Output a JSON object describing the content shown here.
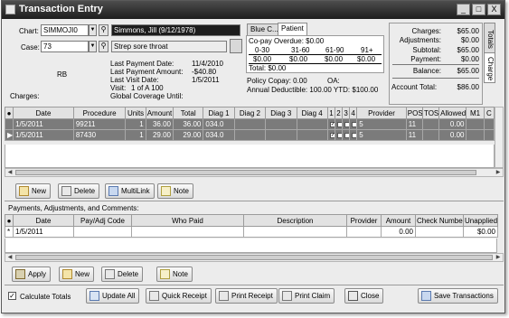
{
  "window": {
    "title": "Transaction Entry",
    "controls": {
      "minimize": "_",
      "maximize": "□",
      "close": "X"
    }
  },
  "patient": {
    "chart_label": "Chart:",
    "chart_value": "SIMMOJI0",
    "chart_name": "Simmons, Jill  (9/12/1978)",
    "case_label": "Case:",
    "case_value": "73",
    "case_desc": "Strep sore throat",
    "rb": "RB",
    "charges_label": "Charges:"
  },
  "payment_info": {
    "last_payment_date_label": "Last Payment Date:",
    "last_payment_date": "11/4/2010",
    "last_payment_amount_label": "Last Payment Amount:",
    "last_payment_amount": "-$40.80",
    "last_visit_date_label": "Last Visit Date:",
    "last_visit_date": "1/5/2011",
    "visit_label": "Visit:",
    "visit_value": "1   of  A 100",
    "global_coverage_label": "Global Coverage Until:"
  },
  "copay_panel": {
    "tabs": [
      "Blue C...",
      "Patient"
    ],
    "copay_overdue": "Co-pay Overdue: $0.00",
    "aging_headers": [
      "0-30",
      "31-60",
      "61-90",
      "91+"
    ],
    "aging_values": [
      "$0.00",
      "$0.00",
      "$0.00",
      "$0.00"
    ],
    "total": "Total: $0.00",
    "policy_copay": "Policy Copay: 0.00",
    "oa": "OA:",
    "annual_deductible": "Annual Deductible:  100.00  YTD:   $100.00"
  },
  "totals": {
    "rows": [
      {
        "label": "Charges:",
        "value": "$65.00"
      },
      {
        "label": "Adjustments:",
        "value": "$0.00"
      },
      {
        "label": "Subtotal:",
        "value": "$65.00"
      },
      {
        "label": "Payment:",
        "value": "$0.00"
      },
      {
        "label": "Balance:",
        "value": "$65.00"
      }
    ],
    "account_total_label": "Account Total:",
    "account_total": "$86.00",
    "side_tabs": [
      "Totals",
      "Charge"
    ]
  },
  "charges_grid": {
    "columns": [
      "Date",
      "Procedure",
      "Units",
      "Amount",
      "Total",
      "Diag 1",
      "Diag 2",
      "Diag 3",
      "Diag 4",
      "1",
      "2",
      "3",
      "4",
      "Provider",
      "POS",
      "TOS",
      "Allowed",
      "M1",
      "C"
    ],
    "rows": [
      {
        "date": "1/5/2011",
        "procedure": "99211",
        "units": "1",
        "amount": "36.00",
        "total": "36.00",
        "diag1": "034.0",
        "provider": "5",
        "pos": "11",
        "allowed": "0.00"
      },
      {
        "date": "1/5/2011",
        "procedure": "87430",
        "units": "1",
        "amount": "29.00",
        "total": "29.00",
        "diag1": "034.0",
        "provider": "5",
        "pos": "11",
        "allowed": "0.00"
      }
    ]
  },
  "charges_buttons": {
    "new": "New",
    "delete": "Delete",
    "multilink": "MultiLink",
    "note": "Note"
  },
  "payments_section_label": "Payments, Adjustments, and Comments:",
  "payments_grid": {
    "columns": [
      "Date",
      "Pay/Adj Code",
      "Who Paid",
      "Description",
      "Provider",
      "Amount",
      "Check Number",
      "Unapplied"
    ],
    "rows": [
      {
        "date": "1/5/2011",
        "amount": "0.00",
        "unapplied": "$0.00"
      }
    ]
  },
  "payments_buttons": {
    "apply": "Apply",
    "new": "New",
    "delete": "Delete",
    "note": "Note"
  },
  "footer": {
    "calculate_totals": "Calculate Totals",
    "update_all": "Update All",
    "quick_receipt": "Quick Receipt",
    "print_receipt": "Print Receipt",
    "print_claim": "Print Claim",
    "close": "Close",
    "save_transactions": "Save Transactions"
  }
}
